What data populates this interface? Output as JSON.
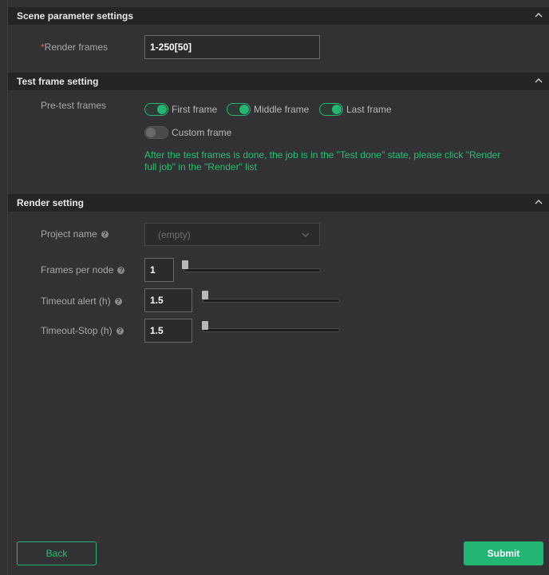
{
  "scene": {
    "header": "Scene parameter settings",
    "render_frames_required": "*",
    "render_frames_label": "Render frames",
    "render_frames_value": "1-250[50]"
  },
  "test_frame": {
    "header": "Test frame setting",
    "pre_test_label": "Pre-test frames",
    "options": [
      {
        "label": "First frame",
        "on": true
      },
      {
        "label": "Middle frame",
        "on": true
      },
      {
        "label": "Last frame",
        "on": true
      },
      {
        "label": "Custom frame",
        "on": false
      }
    ],
    "note": "After the test frames is done, the job is in the \"Test done\" state, please click \"Render full job\" in the \"Render\" list"
  },
  "render": {
    "header": "Render setting",
    "project_name_label": "Project name",
    "project_name_value": "(empty)",
    "frames_per_node_label": "Frames per node",
    "frames_per_node_value": "1",
    "timeout_alert_label": "Timeout alert (h)",
    "timeout_alert_value": "1.5",
    "timeout_stop_label": "Timeout-Stop (h)",
    "timeout_stop_value": "1.5",
    "help_glyph": "?"
  },
  "footer": {
    "back_label": "Back",
    "submit_label": "Submit"
  },
  "colors": {
    "accent": "#22b573",
    "background": "#2f2f31",
    "header_bg": "#252527"
  },
  "icons": {
    "collapse": "chevron-up-icon",
    "dropdown": "chevron-down-icon",
    "help": "question-circle-icon"
  }
}
